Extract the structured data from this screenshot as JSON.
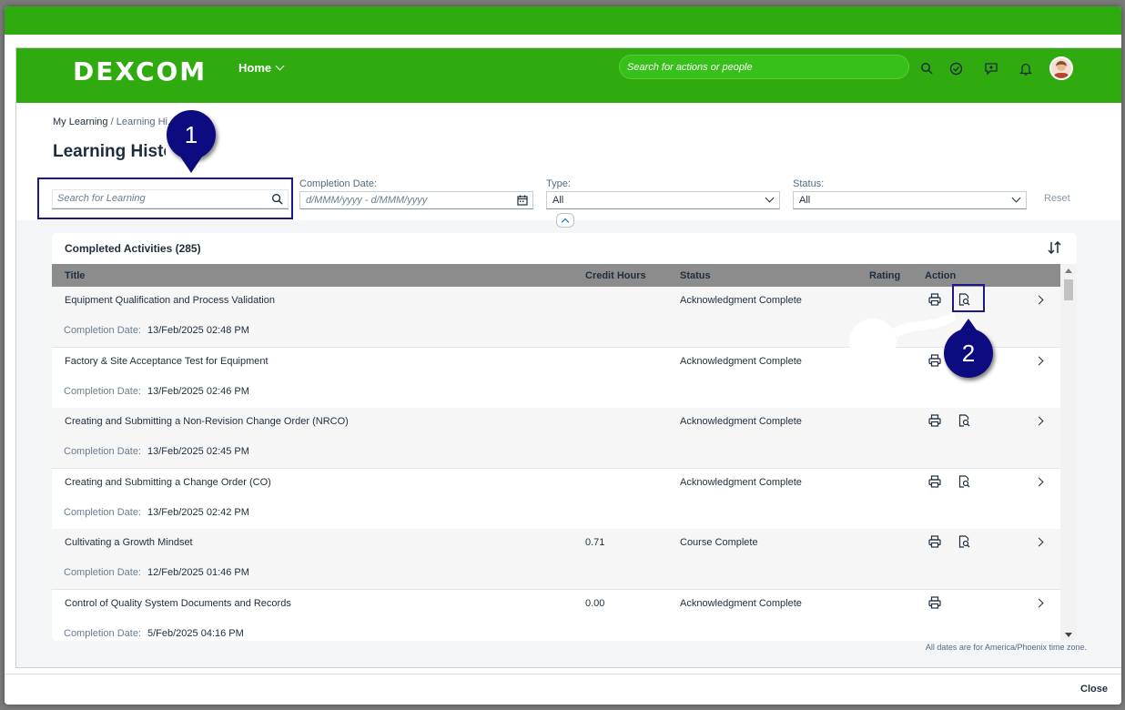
{
  "shell": {
    "logo": "DEXCOM",
    "home_label": "Home",
    "search_placeholder": "Search for actions or people"
  },
  "breadcrumb": {
    "root": "My Learning",
    "separator": "/",
    "current": "Learning Hi..."
  },
  "page_title": "Learning History",
  "filters": {
    "search_placeholder": "Search for Learning",
    "completion_date_label": "Completion Date:",
    "completion_date_placeholder": "d/MMM/yyyy - d/MMM/yyyy",
    "type_label": "Type:",
    "type_value": "All",
    "status_label": "Status:",
    "status_value": "All",
    "reset_label": "Reset"
  },
  "table": {
    "title": "Completed Activities (285)",
    "columns": [
      "Title",
      "Credit Hours",
      "Status",
      "Rating",
      "Action"
    ],
    "completion_date_label": "Completion Date:",
    "rows": [
      {
        "title": "Equipment Qualification and Process Validation",
        "credit": "",
        "status": "Acknowledgment Complete",
        "date": "13/Feb/2025 02:48 PM",
        "has_view": true
      },
      {
        "title": "Factory & Site Acceptance Test for Equipment",
        "credit": "",
        "status": "Acknowledgment Complete",
        "date": "13/Feb/2025 02:46 PM",
        "has_view": true
      },
      {
        "title": "Creating and Submitting a Non-Revision Change Order (NRCO)",
        "credit": "",
        "status": "Acknowledgment Complete",
        "date": "13/Feb/2025 02:45 PM",
        "has_view": true
      },
      {
        "title": "Creating and Submitting a Change Order (CO)",
        "credit": "",
        "status": "Acknowledgment Complete",
        "date": "13/Feb/2025 02:42 PM",
        "has_view": true
      },
      {
        "title": "Cultivating a Growth Mindset",
        "credit": "0.71",
        "status": "Course Complete",
        "date": "12/Feb/2025 01:46 PM",
        "has_view": true
      },
      {
        "title": "Control of Quality System Documents and Records",
        "credit": "0.00",
        "status": "Acknowledgment Complete",
        "date": "5/Feb/2025 04:16 PM",
        "has_view": false
      }
    ]
  },
  "timezone_note": "All dates are for America/Phoenix time zone.",
  "footer": {
    "close_label": "Close"
  },
  "annotations": {
    "marker1": "1",
    "marker2": "2"
  },
  "colors": {
    "brand_green": "#2fab10",
    "marker_blue": "#0c0c80"
  }
}
